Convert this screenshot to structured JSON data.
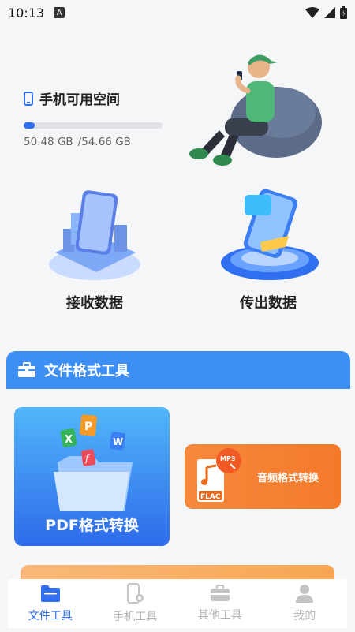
{
  "status_bar": {
    "time": "10:13",
    "notification_icon": "A"
  },
  "storage": {
    "title": "手机可用空间",
    "used": "50.48 GB",
    "total": "/54.66 GB",
    "used_fraction": 0.08
  },
  "actions": [
    {
      "label": "接收数据"
    },
    {
      "label": "传出数据"
    }
  ],
  "tools_section": {
    "title": "文件格式工具"
  },
  "tools": {
    "pdf": {
      "label": "PDF格式转换"
    },
    "audio": {
      "label": "音频格式转换",
      "badge_top": "MP3",
      "badge_bottom": "FLAC"
    }
  },
  "doc_icons": {
    "p": "P",
    "x": "X",
    "w": "W",
    "f": "f"
  },
  "tabs": [
    {
      "label": "文件工具",
      "active": true
    },
    {
      "label": "手机工具",
      "active": false
    },
    {
      "label": "其他工具",
      "active": false
    },
    {
      "label": "我的",
      "active": false
    }
  ],
  "colors": {
    "accent": "#2f6ff0",
    "section": "#3d8ff5",
    "audio": "#f47a2a"
  }
}
